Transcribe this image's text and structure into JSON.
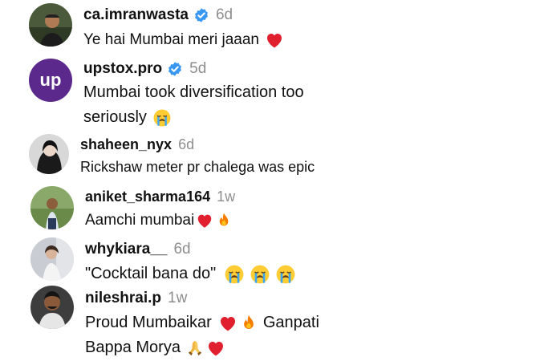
{
  "comments": [
    {
      "username": "ca.imranwasta",
      "verified": true,
      "time": "6d",
      "line1_text": "Ye hai Mumbai meri jaaan",
      "line2_text": ""
    },
    {
      "username": "upstox.pro",
      "verified": true,
      "time": "5d",
      "avatar_text": "up",
      "line1_text": "Mumbai took diversification too",
      "line2_text": "seriously"
    },
    {
      "username": "shaheen_nyx",
      "verified": false,
      "time": "6d",
      "line1_text": "Rickshaw meter pr chalega was epic",
      "line2_text": ""
    },
    {
      "username": "aniket_sharma164",
      "verified": false,
      "time": "1w",
      "line1_text": "Aamchi mumbai",
      "line2_text": ""
    },
    {
      "username": "whykiara__",
      "verified": false,
      "time": "6d",
      "line1_text": "\"Cocktail bana do\"",
      "line2_text": ""
    },
    {
      "username": "nileshrai.p",
      "verified": false,
      "time": "1w",
      "line1_text": "Proud Mumbaikar",
      "line1_text_b": "Ganpati",
      "line2_text": "Bappa Morya"
    }
  ],
  "emoji": {
    "c1": [
      "red-heart"
    ],
    "c2": [
      "crying-face"
    ],
    "c4": [
      "red-heart",
      "fire"
    ],
    "c5": [
      "crying-face",
      "crying-face",
      "crying-face"
    ],
    "c6_line1": [
      "red-heart",
      "fire"
    ],
    "c6_line2": [
      "folded-hands",
      "red-heart"
    ]
  },
  "colors": {
    "verified_blue": "#3897f0",
    "upstox_purple": "#5a298b",
    "heart_red": "#e0202e",
    "fire_orange": "#f57c00",
    "time_gray": "#8e8e8e"
  }
}
